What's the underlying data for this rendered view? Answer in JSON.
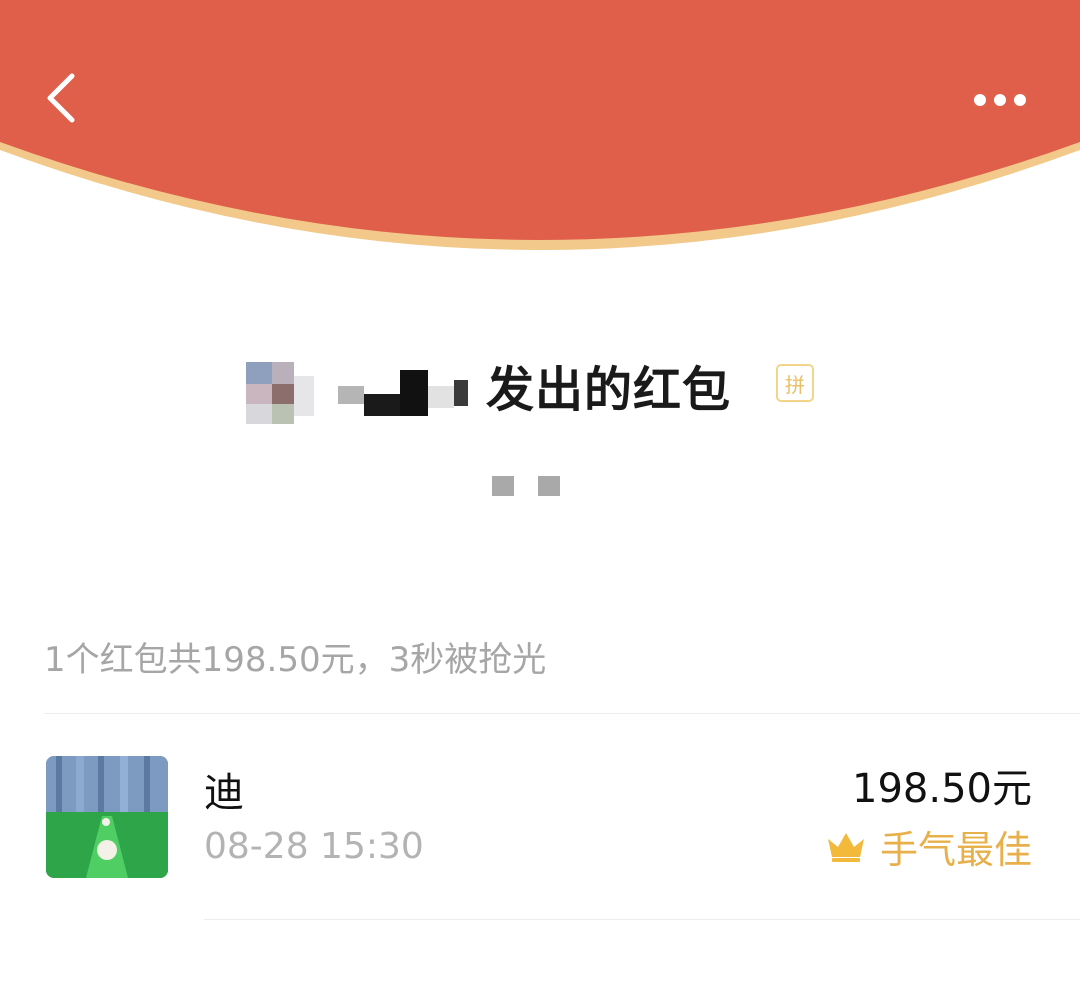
{
  "header": {
    "background_color": "#e05f4a",
    "rim_color": "#f2c98a",
    "back_icon": "chevron-left-icon",
    "more_icon": "more-dots-icon"
  },
  "sender": {
    "title": "发出的红包",
    "pin_badge": "拼"
  },
  "summary": {
    "text": "1个红包共198.50元，3秒被抢光"
  },
  "receivers": [
    {
      "name": "迪",
      "time": "08-28 15:30",
      "amount": "198.50元",
      "best_luck_label": "手气最佳",
      "best_luck_icon": "crown-icon",
      "best_luck_color": "#e8b04a"
    }
  ]
}
